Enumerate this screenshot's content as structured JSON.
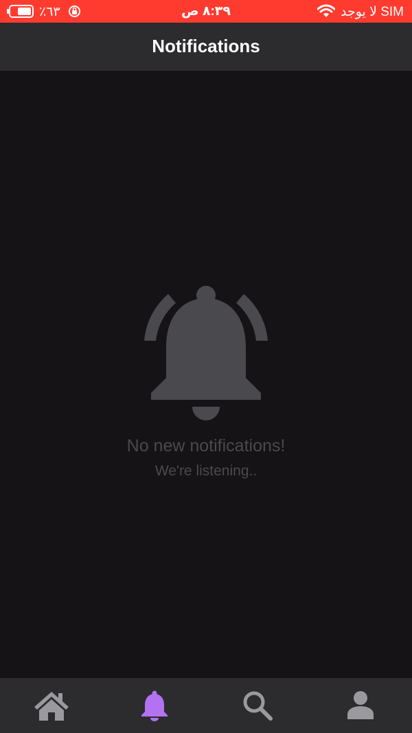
{
  "status_bar": {
    "battery_percent": "٦٣٪",
    "battery_level": 0.63,
    "time": "٨:٣٩ ص",
    "carrier": "لا يوجد SIM",
    "background_color": "#ff3b30"
  },
  "nav": {
    "title": "Notifications"
  },
  "empty_state": {
    "icon": "bell-ringing-icon",
    "title": "No new notifications!",
    "subtitle": "We're listening.."
  },
  "tabs": [
    {
      "name": "home",
      "icon": "home-icon",
      "active": false
    },
    {
      "name": "notifications",
      "icon": "bell-icon",
      "active": true
    },
    {
      "name": "search",
      "icon": "search-icon",
      "active": false
    },
    {
      "name": "profile",
      "icon": "person-icon",
      "active": false
    }
  ],
  "colors": {
    "background": "#151316",
    "bar": "#2c2b2e",
    "accent": "#b272f2",
    "inactive_icon": "#9a9a9e",
    "muted": "#4a494d"
  }
}
